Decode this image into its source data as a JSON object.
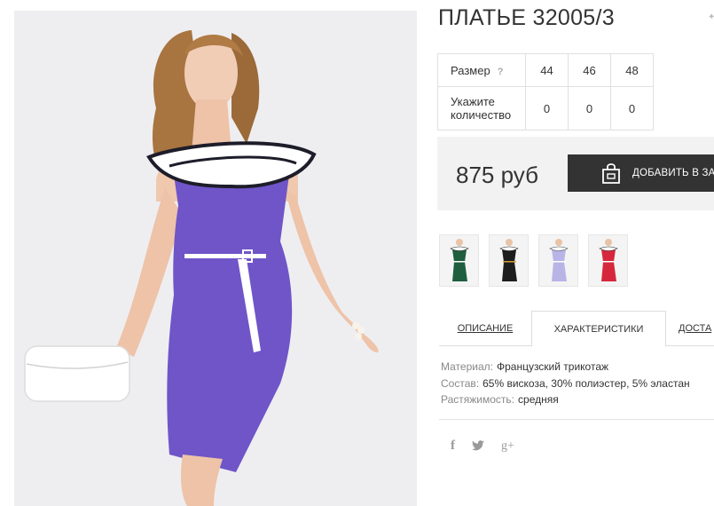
{
  "product": {
    "title": "ПЛАТЬЕ 32005/3"
  },
  "sizes": {
    "size_label": "Размер",
    "help_mark": "?",
    "values": [
      "44",
      "46",
      "48"
    ],
    "qty_label_line1": "Укажите",
    "qty_label_line2": "количество",
    "quantities": [
      "0",
      "0",
      "0"
    ]
  },
  "purchase": {
    "price": "875 руб",
    "cart_label": "ДОБАВИТЬ В ЗАК"
  },
  "thumbnails": [
    {
      "icon": "dress-thumbnail-green",
      "color": "#1f5e3e"
    },
    {
      "icon": "dress-thumbnail-black",
      "color": "#1d1d1d"
    },
    {
      "icon": "dress-thumbnail-lavender",
      "color": "#b8b4e6"
    },
    {
      "icon": "dress-thumbnail-red",
      "color": "#d6283c"
    }
  ],
  "tabs": {
    "description": "ОПИСАНИЕ",
    "characteristics": "ХАРАКТЕРИСТИКИ",
    "delivery": "ДОСТА"
  },
  "characteristics": [
    {
      "key": "Материал:",
      "value": "Французский трикотаж"
    },
    {
      "key": "Состав:",
      "value": "65% вискоза, 30% полиэстер, 5% эластан"
    },
    {
      "key": "Растяжимость:",
      "value": "средняя"
    }
  ],
  "social": {
    "facebook": "f",
    "twitter": "twitter-bird",
    "googleplus": "g+"
  },
  "colors": {
    "dress_main": "#6f55c8",
    "button_bg": "#333333",
    "price_block_bg": "#f2f2f2"
  }
}
